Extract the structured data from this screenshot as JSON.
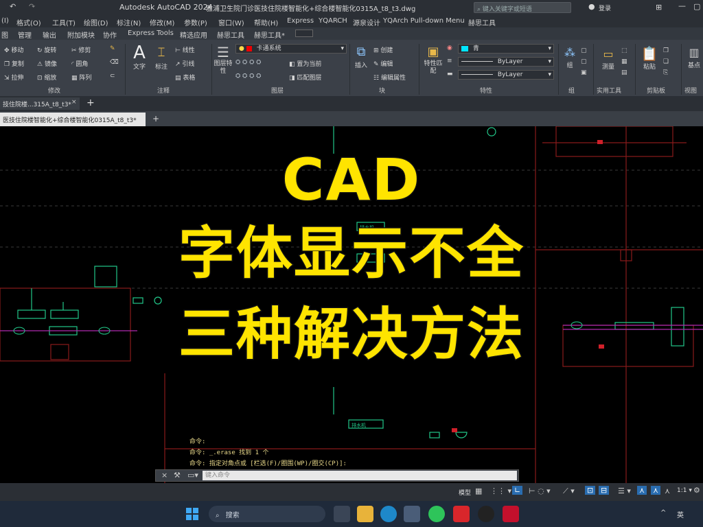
{
  "window": {
    "app_title": "Autodesk AutoCAD 2024",
    "file_title": "雅浦卫生院门诊医技住院楼智能化+综合楼智能化0315A_t8_t3.dwg",
    "search_placeholder": "键入关键字或短语",
    "user": "登录"
  },
  "menu": [
    "(I)",
    "格式(O)",
    "工具(T)",
    "绘图(D)",
    "标注(N)",
    "修改(M)",
    "参数(P)",
    "窗口(W)",
    "帮助(H)",
    "Express",
    "YQARCH",
    "源泉设计",
    "YQArch Pull-down Menu",
    "赫思工具"
  ],
  "ribbon_tabs": [
    "图",
    "管理",
    "输出",
    "附加模块",
    "协作",
    "Express Tools",
    "精选应用",
    "赫思工具",
    "赫思工具*"
  ],
  "ribbon": {
    "modify": {
      "items": [
        "移动",
        "旋转",
        "修剪",
        "复制",
        "镜像",
        "圆角",
        "拉伸",
        "缩放",
        "阵列"
      ],
      "label": "修改"
    },
    "annotate": {
      "text": "文字",
      "dim": "标注",
      "linear": "线性",
      "leader": "引线",
      "table": "表格",
      "label": "注释"
    },
    "layers": {
      "layer_name": "卡通系统",
      "props": "图层特性",
      "set_current": "置为当前",
      "match": "匹配图层",
      "label": "图层"
    },
    "block": {
      "insert": "插入",
      "create": "创建",
      "edit": "编辑",
      "edit_attr": "编辑属性",
      "label": "块"
    },
    "properties": {
      "match": "特性匹配",
      "color": "青",
      "linetype": "ByLayer",
      "lineweight": "ByLayer",
      "label": "特性"
    },
    "group": {
      "label": "组",
      "name": "组"
    },
    "utilities": {
      "measure": "测量",
      "label": "实用工具"
    },
    "clipboard": {
      "paste": "粘贴",
      "label": "剪贴板"
    },
    "view": {
      "base": "基点",
      "label": "视图"
    }
  },
  "doc_tabs": {
    "tab1": "技住院楼...315A_t8_t3*",
    "tab2": "医技住院楼智能化+综合楼智能化0315A_t8_t3*",
    "add": "+"
  },
  "overlay": {
    "line1": "CAD",
    "line2": "字体显示不全",
    "line3": "三种解决方法"
  },
  "drawing_labels": {
    "box1": "排水机",
    "box2": "排水机"
  },
  "command": {
    "history": [
      "命令:",
      "命令: _.erase 找到 1 个",
      "命令: 指定对角点或 [栏选(F)/圈围(WP)/圈交(CP)]:"
    ],
    "placeholder": "键入命令"
  },
  "status": {
    "model": "模型",
    "scale": "1:1"
  },
  "taskbar": {
    "search": "搜索",
    "lang": "英"
  },
  "colors": {
    "caption": "#ffe400",
    "ribbon_bg": "#3b4048",
    "titlebar_bg": "#2b2f35"
  }
}
